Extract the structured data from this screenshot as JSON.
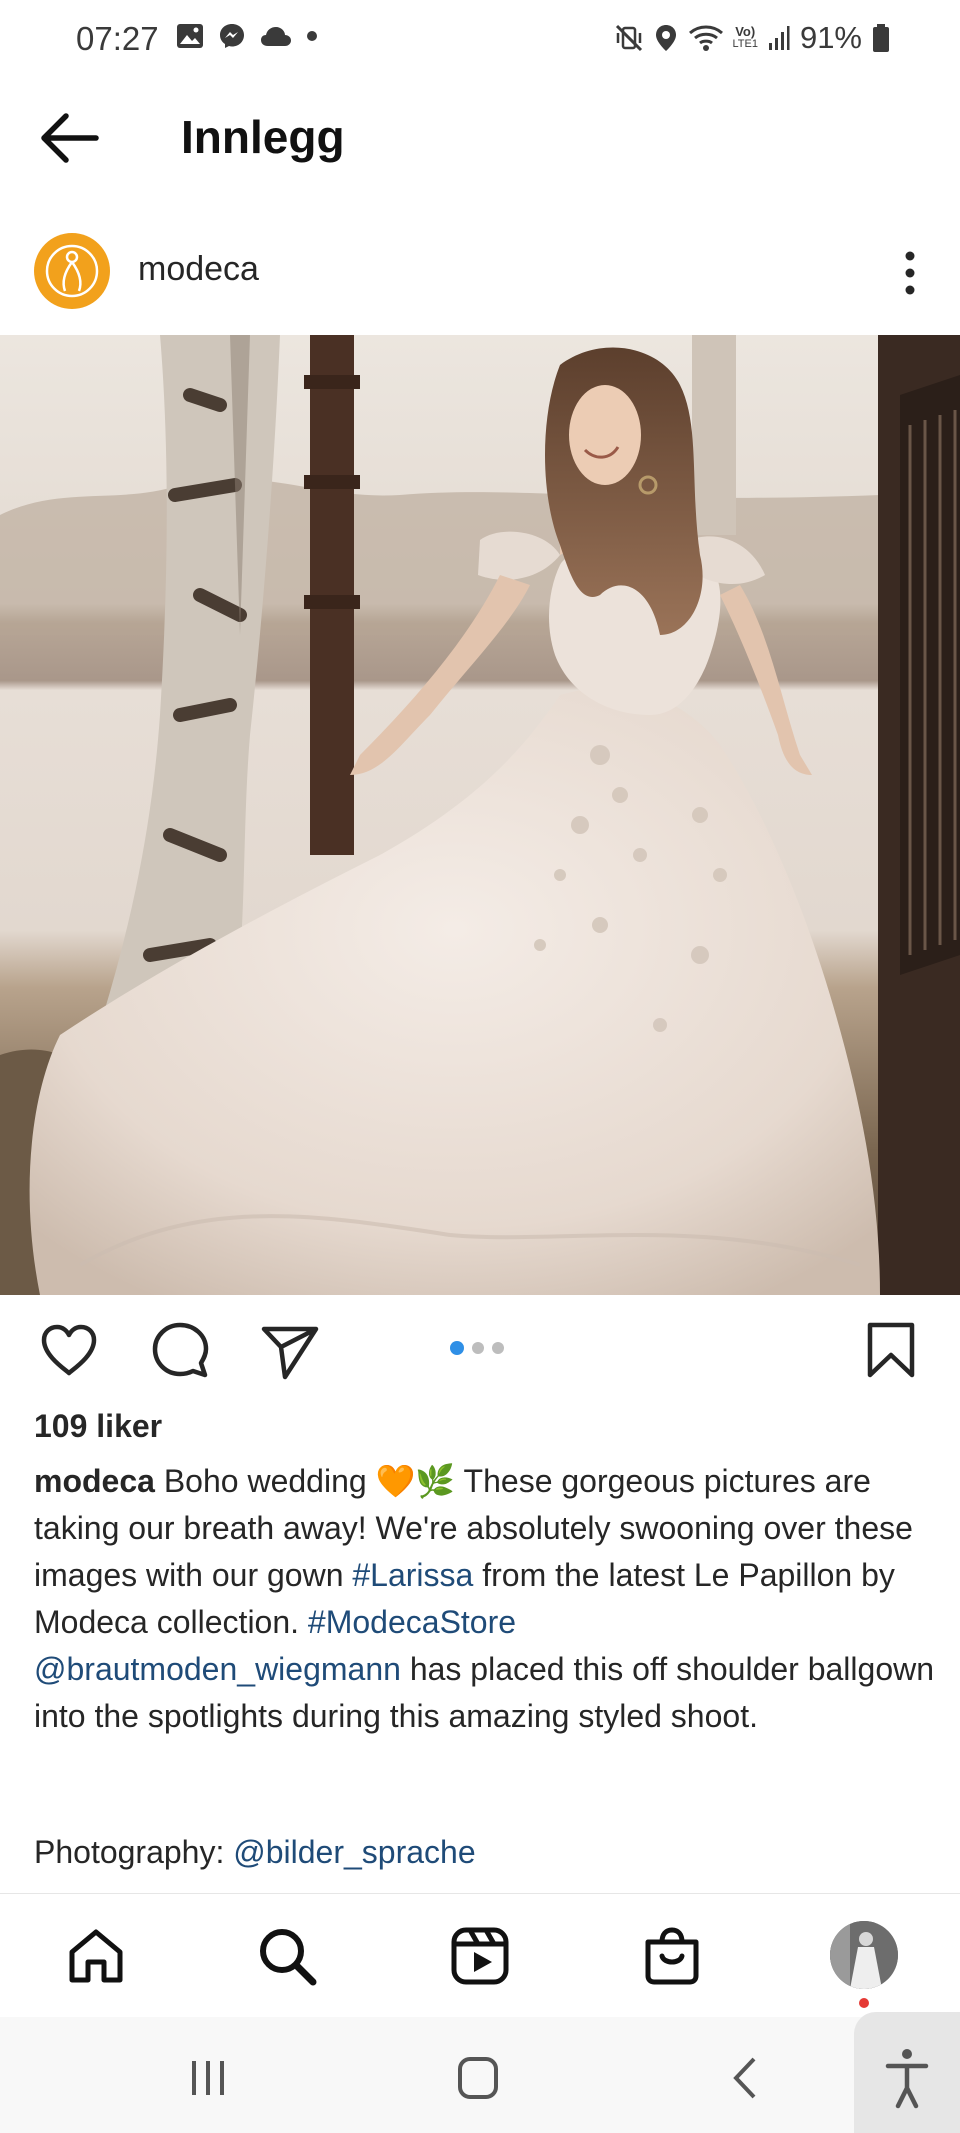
{
  "status_bar": {
    "time": "07:27",
    "battery": "91%",
    "left_icons": [
      "gallery-icon",
      "messenger-icon",
      "cloud-icon",
      "dot-icon"
    ],
    "right_icons": [
      "mute-vibrate-icon",
      "location-icon",
      "wifi-icon",
      "volte-icon",
      "signal-icon",
      "battery-icon"
    ],
    "volte_label_top": "Vo)",
    "volte_label_bottom": "LTE1"
  },
  "header": {
    "title": "Innlegg",
    "back_icon": "arrow-left-icon"
  },
  "post": {
    "username": "modeca",
    "avatar_color": "#f2a11c",
    "more_icon": "kebab-menu-icon",
    "image_description_icon": "wedding-photo",
    "carousel": {
      "count": 3,
      "active_index": 0
    },
    "likes": "109 liker",
    "caption": {
      "user": "modeca",
      "part1": " Boho wedding 🧡🌿 These gorgeous pictures are taking our breath away! We're absolutely swooning over these images with our gown ",
      "tag1": "#Larissa",
      "part2": " from the latest Le Papillon by Modeca collection. ",
      "tag2": "#ModecaStore",
      "mention1": "@brautmoden_wiegmann",
      "part3": "  has placed this off shoulder ballgown into the spotlights during this amazing styled shoot."
    },
    "photography_label": "Photography: ",
    "photography_mention": "@bilder_sprache"
  },
  "actions": {
    "like_icon": "heart-icon",
    "comment_icon": "comment-icon",
    "share_icon": "send-icon",
    "save_icon": "bookmark-icon"
  },
  "bottom_nav": {
    "items": [
      "home-icon",
      "search-icon",
      "reels-icon",
      "shop-icon",
      "profile-avatar"
    ]
  },
  "colors": {
    "accent_blue": "#2f8fe6",
    "link_blue": "#1f4b78",
    "notification_red": "#e53935"
  }
}
